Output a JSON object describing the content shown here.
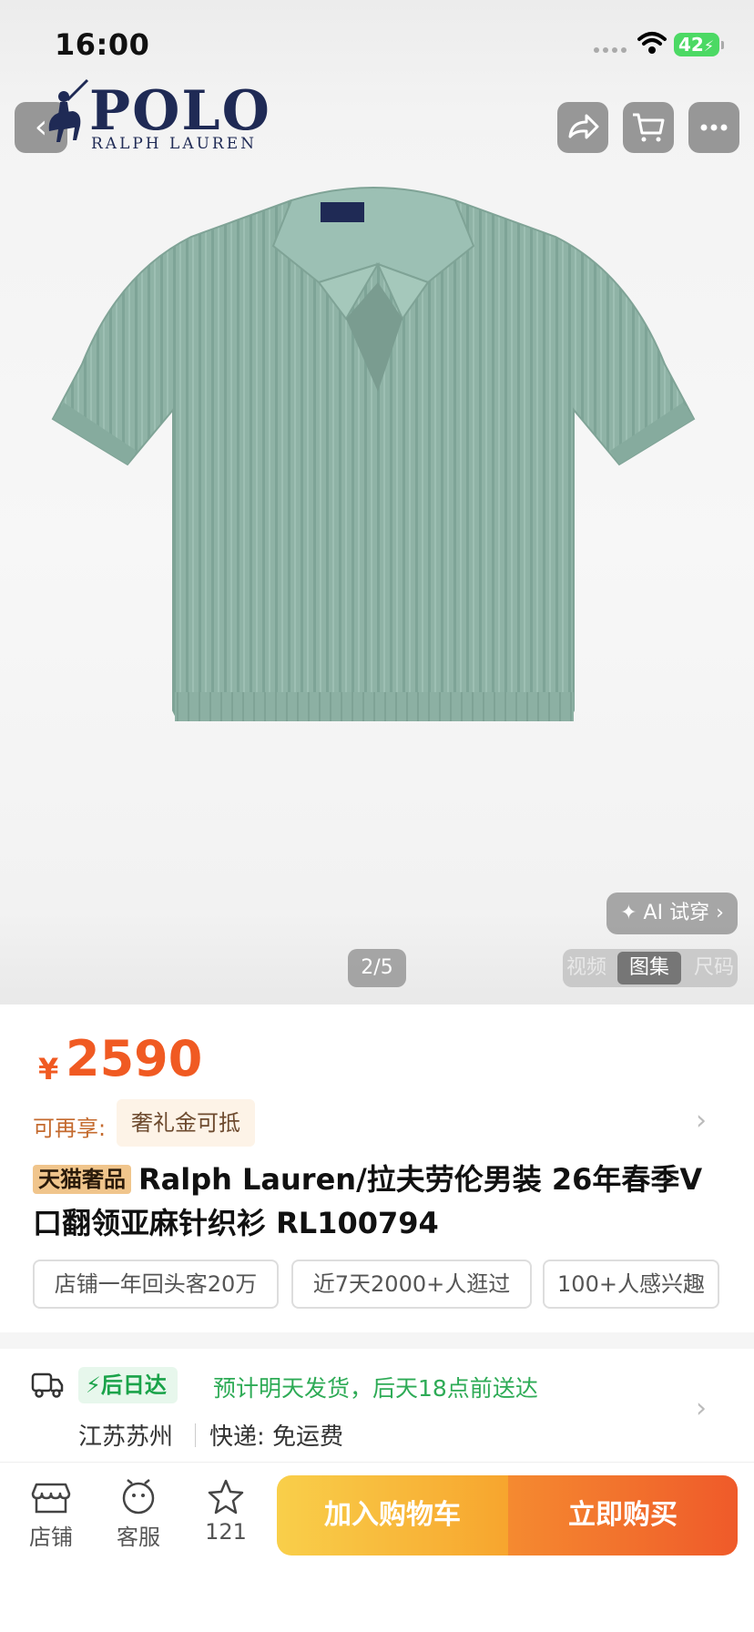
{
  "status_bar": {
    "time": "16:00",
    "battery": "42"
  },
  "brand": {
    "name": "POLO",
    "sub": "RALPH LAUREN"
  },
  "gallery": {
    "ai_try_on": "✦ AI 试穿 ›",
    "page_indicator": "2/5",
    "tabs": [
      "视频",
      "图集",
      "尺码"
    ],
    "active_tab": "图集"
  },
  "price": {
    "currency": "¥",
    "value": "2590"
  },
  "benefit": {
    "label": "可再享:",
    "tag": "奢礼金可抵"
  },
  "product": {
    "store_tag": "天猫奢品",
    "title": "Ralph Lauren/拉夫劳伦男装 26年春季V口翻领亚麻针织衫 RL100794"
  },
  "chips": [
    "店铺一年回头客20万",
    "近7天2000+人逛过",
    "100+人感兴趣"
  ],
  "delivery": {
    "badge": "后日达",
    "eta": "预计明天发货，后天18点前送达",
    "origin": "江苏苏州",
    "shipping": "快递: 免运费"
  },
  "bottom_bar": {
    "store": "店铺",
    "service": "客服",
    "favorites": "121",
    "add_to_cart": "加入购物车",
    "buy_now": "立即购买"
  },
  "colors": {
    "accent_orange": "#f05a22",
    "delivery_green": "#1aa34a",
    "shirt": "#8fb3a6"
  }
}
